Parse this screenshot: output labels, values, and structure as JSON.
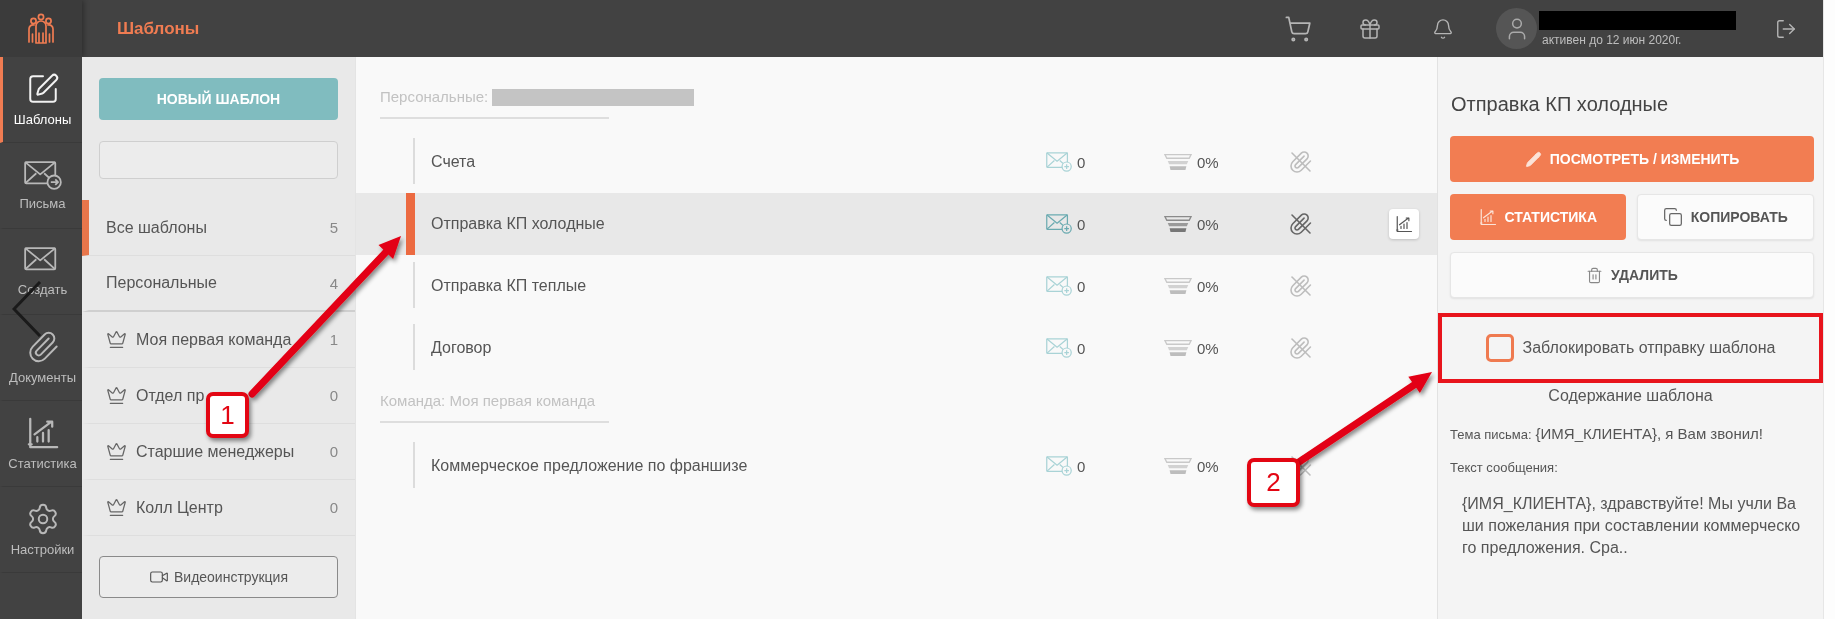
{
  "app": {
    "title": "Шаблоны"
  },
  "user": {
    "name_redacted": true,
    "status": "активен до 12 июн 2020г."
  },
  "nav": [
    {
      "label": "Шаблоны",
      "selected": true
    },
    {
      "label": "Письма",
      "selected": false
    },
    {
      "label": "Создать",
      "selected": false
    },
    {
      "label": "Документы",
      "selected": false
    },
    {
      "label": "Статистика",
      "selected": false
    },
    {
      "label": "Настройки",
      "selected": false
    }
  ],
  "sidebar": {
    "new_button": "НОВЫЙ ШАБЛОН",
    "filters": [
      {
        "kind": "plain",
        "label": "Все шаблоны",
        "count": "5",
        "selected": true
      },
      {
        "kind": "plain",
        "label": "Персональные",
        "count": "4",
        "selected": false
      },
      {
        "kind": "team",
        "label": "Моя первая команда",
        "count": "1",
        "selected": false
      },
      {
        "kind": "team",
        "label": "Отдел пр",
        "count": "0",
        "selected": false
      },
      {
        "kind": "team",
        "label": "Старшие менеджеры",
        "count": "0",
        "selected": false
      },
      {
        "kind": "team",
        "label": "Колл Центр",
        "count": "0",
        "selected": false
      }
    ],
    "video_button": "Видеоинструкция"
  },
  "sections": [
    {
      "title": "Персональные:",
      "redacted": true,
      "templates": [
        {
          "name": "Счета",
          "sent": "0",
          "rate": "0%",
          "attachment": false,
          "selected": false
        },
        {
          "name": "Отправка КП холодные",
          "sent": "0",
          "rate": "0%",
          "attachment": false,
          "selected": true
        },
        {
          "name": "Отправка КП теплые",
          "sent": "0",
          "rate": "0%",
          "attachment": false,
          "selected": false
        },
        {
          "name": "Договор",
          "sent": "0",
          "rate": "0%",
          "attachment": false,
          "selected": false
        }
      ]
    },
    {
      "title": "Команда: Моя первая команда",
      "templates": [
        {
          "name": "Коммерческое предложение по франшизе",
          "sent": "0",
          "rate": "0%",
          "attachment": false,
          "selected": false
        }
      ]
    }
  ],
  "details": {
    "title": "Отправка КП холодные",
    "action_rows": [
      [
        {
          "kind": "primary",
          "label": "ПОСМОТРЕТЬ / ИЗМЕНИТЬ"
        }
      ],
      [
        {
          "kind": "primary",
          "label": "СТАТИСТИКА"
        },
        {
          "kind": "secondary",
          "label": "КОПИРОВАТЬ"
        }
      ],
      [
        {
          "kind": "secondary",
          "label": "УДАЛИТЬ"
        }
      ]
    ],
    "lock": {
      "label": "Заблокировать отправку шаблона",
      "checked": false,
      "highlighted": true
    },
    "content": {
      "heading": "Содержание шаблона",
      "subject_label": "Тема письма:",
      "subject": "{ИМЯ_КЛИЕНТА}, я Вам звонил!",
      "message_label": "Текст сообщения:",
      "message": "{ИМЯ_КЛИЕНТА}, здравствуйте! Мы учли Ваши пожелания при составлении коммерческого предложения. Сра.."
    }
  },
  "annotations": [
    {
      "label": "1"
    },
    {
      "label": "2"
    }
  ]
}
